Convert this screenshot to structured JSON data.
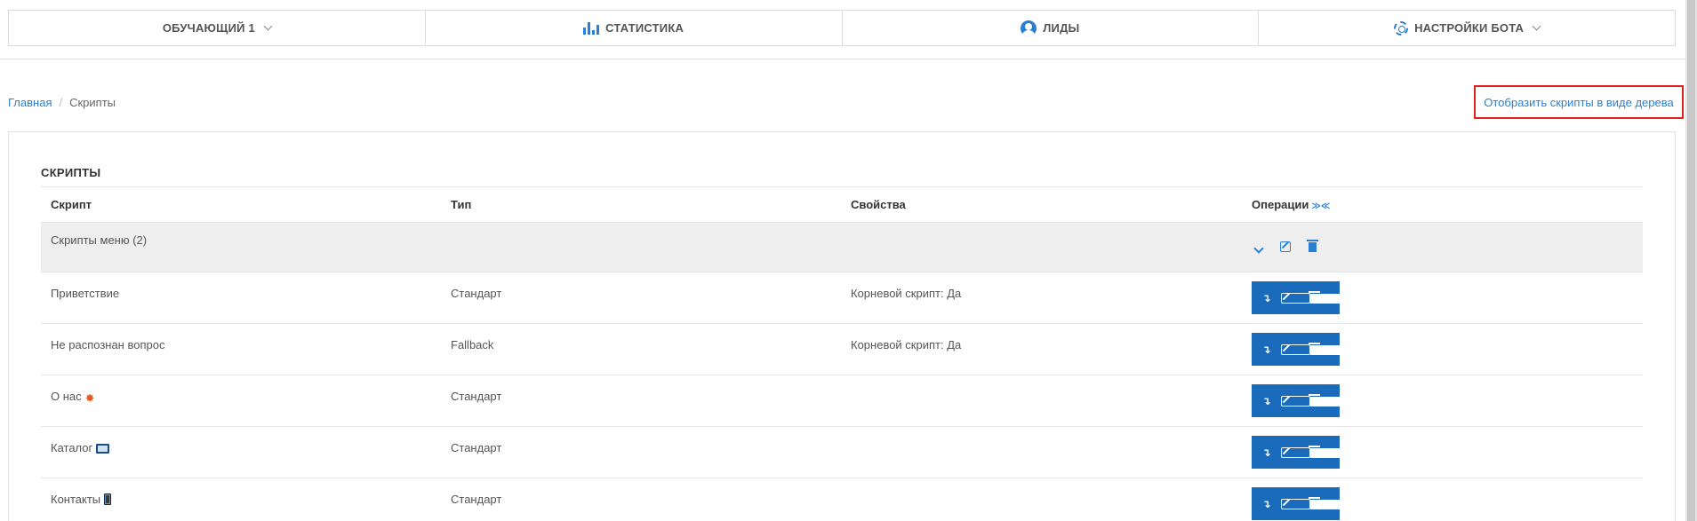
{
  "nav": {
    "bot_name": "ОБУЧАЮЩИЙ 1",
    "statistics": "СТАТИСТИКА",
    "leads": "ЛИДЫ",
    "bot_settings": "НАСТРОЙКИ БОТА",
    "accent_color": "#2a7fd4"
  },
  "breadcrumb": {
    "home": "Главная",
    "separator": "/",
    "current": "Скрипты"
  },
  "tree_view_link": "Отобразить скрипты в виде дерева",
  "panel": {
    "title": "СКРИПТЫ",
    "columns": {
      "script": "Скрипт",
      "type": "Тип",
      "properties": "Свойства",
      "operations": "Операции",
      "sort_icons": "≫≪"
    },
    "group_row": {
      "name": "Скрипты меню (2)"
    },
    "rows": [
      {
        "name": "Приветствие",
        "type": "Стандарт",
        "properties": "Корневой скрипт: Да",
        "emoji": ""
      },
      {
        "name": "Не распознан вопрос",
        "type": "Fallback",
        "properties": "Корневой скрипт: Да",
        "emoji": ""
      },
      {
        "name": "О нас",
        "type": "Стандарт",
        "properties": "",
        "emoji": "boom-icon"
      },
      {
        "name": "Каталог",
        "type": "Стандарт",
        "properties": "",
        "emoji": "laptop-icon"
      },
      {
        "name": "Контакты",
        "type": "Стандарт",
        "properties": "",
        "emoji": "phone-icon"
      }
    ]
  },
  "colors": {
    "ops_button": "#1b6bbd",
    "highlight_border": "#e21f1f",
    "group_row_bg": "#eeeeee"
  }
}
